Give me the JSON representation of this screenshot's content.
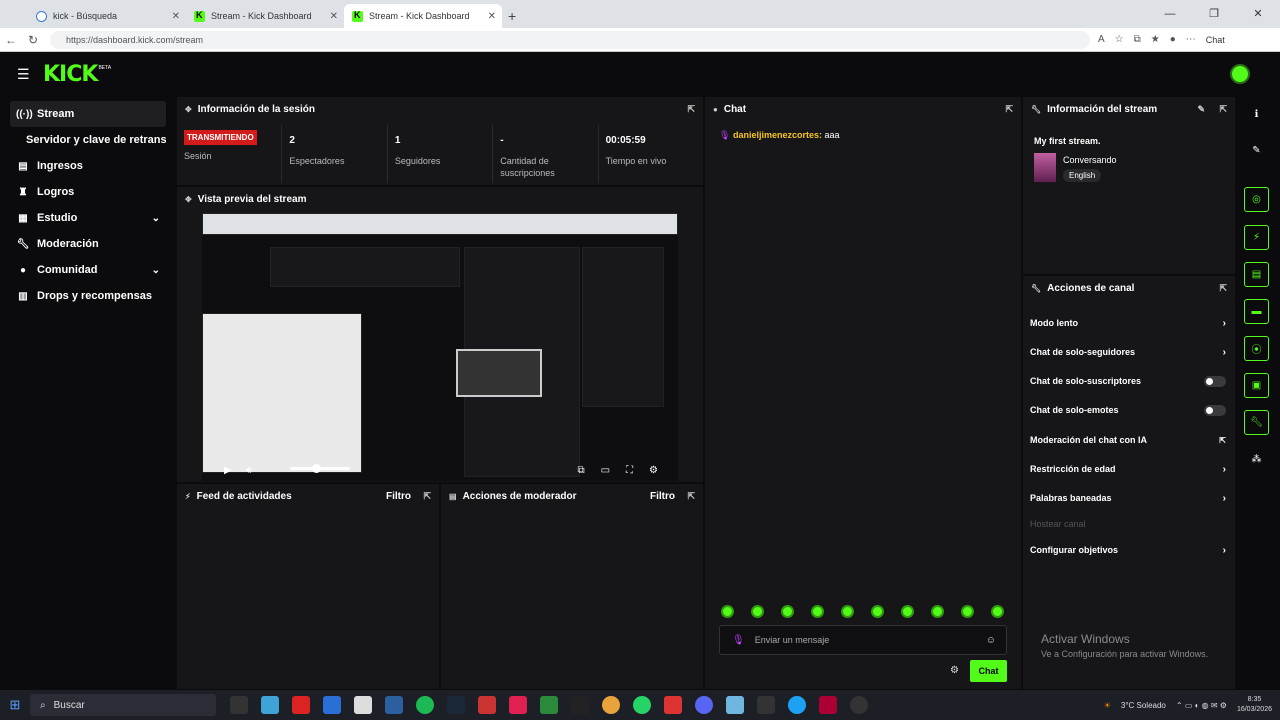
{
  "browser": {
    "tabs": [
      {
        "label": "kick - Búsqueda",
        "active": false
      },
      {
        "label": "Stream - Kick Dashboard",
        "active": false
      },
      {
        "label": "Stream - Kick Dashboard",
        "active": true
      }
    ],
    "url": "https://dashboard.kick.com/stream",
    "copilot_label": "Chat"
  },
  "header": {
    "logo": "KICK",
    "beta": "BETA"
  },
  "sidebar": {
    "items": [
      {
        "label": "Stream",
        "icon": "broadcast-icon"
      },
      {
        "label": "Servidor y clave de retransmisión",
        "icon": ""
      },
      {
        "label": "Ingresos",
        "icon": "chart-icon"
      },
      {
        "label": "Logros",
        "icon": "trophy-icon"
      },
      {
        "label": "Estudio",
        "icon": "studio-icon"
      },
      {
        "label": "Moderación",
        "icon": "wrench-icon"
      },
      {
        "label": "Comunidad",
        "icon": "community-icon"
      },
      {
        "label": "Drops y recompensas",
        "icon": "gift-icon"
      }
    ]
  },
  "session": {
    "title": "Información de la sesión",
    "status_badge": "TRANSMITIENDO",
    "stats": [
      {
        "value": "",
        "label": "Sesión"
      },
      {
        "value": "2",
        "label": "Espectadores"
      },
      {
        "value": "1",
        "label": "Seguidores"
      },
      {
        "value": "-",
        "label": "Cantidad de suscripciones"
      },
      {
        "value": "00:05:59",
        "label": "Tiempo en vivo"
      }
    ]
  },
  "preview": {
    "title": "Vista previa del stream"
  },
  "activity": {
    "title": "Feed de actividades",
    "filter": "Filtro"
  },
  "modactions": {
    "title": "Acciones de moderador",
    "filter": "Filtro"
  },
  "chat": {
    "title": "Chat",
    "messages": [
      {
        "user": "danieljimenezcortes",
        "text": "aaa"
      }
    ],
    "input_placeholder": "Enviar un mensaje",
    "send_label": "Chat"
  },
  "stream_info": {
    "title": "Información del stream",
    "stream_title": "My first stream.",
    "category": "Conversando",
    "language": "English"
  },
  "channel_actions": {
    "title": "Acciones de canal",
    "items": [
      {
        "label": "Modo lento",
        "control": "arrow"
      },
      {
        "label": "Chat de solo-seguidores",
        "control": "arrow"
      },
      {
        "label": "Chat de solo-suscriptores",
        "control": "toggle",
        "on": false
      },
      {
        "label": "Chat de solo-emotes",
        "control": "toggle",
        "on": false
      },
      {
        "label": "Moderación del chat con IA",
        "control": "external"
      },
      {
        "label": "Restricción de edad",
        "control": "arrow"
      },
      {
        "label": "Palabras baneadas",
        "control": "arrow"
      },
      {
        "label": "Hostear canal",
        "control": "none",
        "disabled": true
      },
      {
        "label": "Configurar objetivos",
        "control": "arrow"
      }
    ]
  },
  "watermark": {
    "line1": "Activar Windows",
    "line2": "Ve a Configuración para activar Windows."
  },
  "taskbar": {
    "search_placeholder": "Buscar",
    "weather": "3°C  Soleado",
    "time": "8:35",
    "date": "16/03/2026"
  },
  "colors": {
    "accent": "#53fc18",
    "live": "#d41b1b",
    "panel": "#161619",
    "background": "#0b0b0d"
  }
}
